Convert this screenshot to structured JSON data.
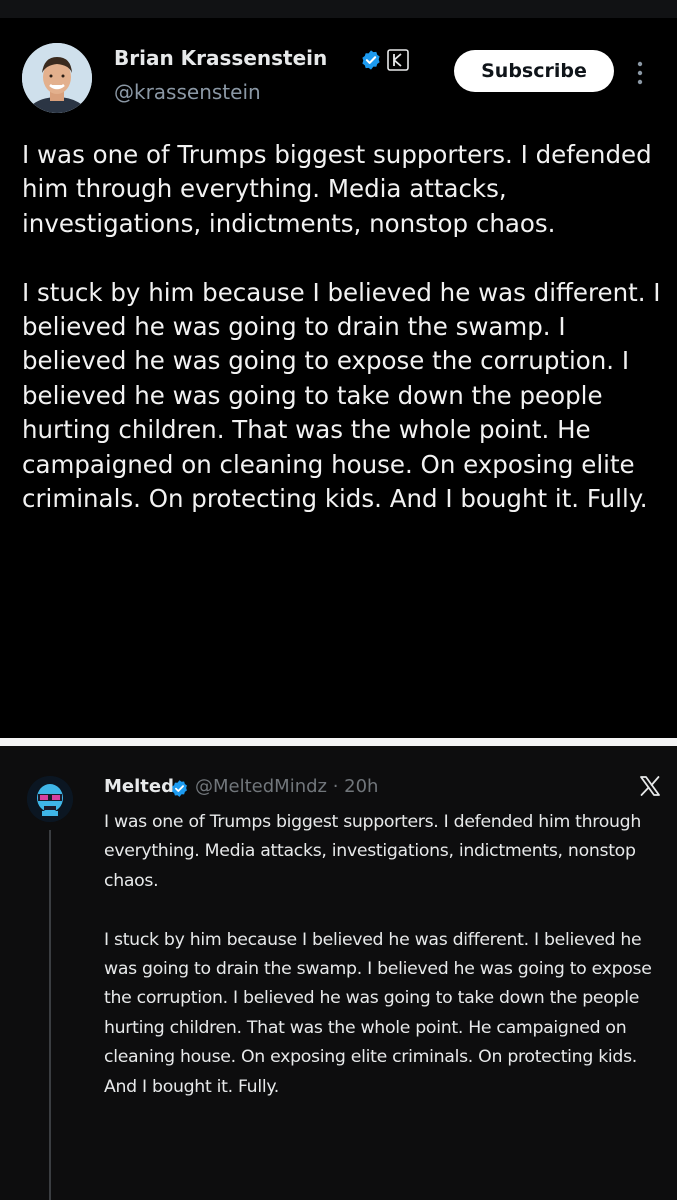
{
  "post": {
    "author_name": "Brian Krassenstein",
    "author_handle": "@krassenstein",
    "subscribe_label": "Subscribe",
    "paragraphs": [
      "I was one of Trumps biggest supporters. I defended him through everything. Media attacks, investigations, indictments, nonstop chaos.",
      "I stuck by him because I believed he was different. I believed he was going to drain the swamp. I believed he was going to expose the corruption. I believed he was going to take down the people hurting children. That was the whole point. He campaigned on cleaning house. On exposing elite criminals. On protecting kids. And I bought it. Fully."
    ],
    "verified_color": "#1d9bf0",
    "icons": [
      "verified-badge-icon",
      "affiliate-k-icon",
      "more-options-icon"
    ]
  },
  "quoted": {
    "author_name": "Melted",
    "author_handle": "@MeltedMindz · 20h",
    "paragraphs": [
      "I was one of Trumps biggest supporters. I defended him through everything. Media attacks, investigations, indictments, nonstop chaos.",
      "I stuck by him because I believed he was different. I believed he was going to drain the swamp. I believed he was going to expose the corruption. I believed he was going to take down the people hurting children. That was the whole point. He campaigned on cleaning house. On exposing elite criminals. On protecting kids. And I bought it. Fully."
    ],
    "icons": [
      "verified-badge-icon",
      "x-logo-icon"
    ]
  }
}
